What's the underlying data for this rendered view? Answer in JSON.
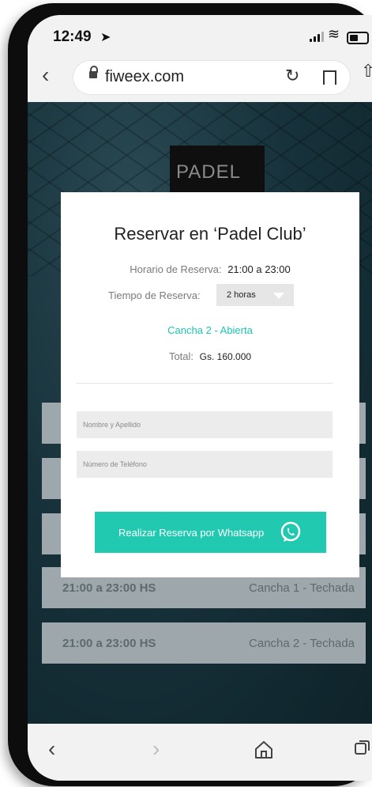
{
  "status_bar": {
    "time": "12:49"
  },
  "address_bar": {
    "url": "fiweex.com"
  },
  "background": {
    "logo_text": "PADEL",
    "slots": [
      {
        "time": "21:00 a 23:00 HS",
        "court": "Cancha 1 - Techada"
      },
      {
        "time": "21:00 a 23:00 HS",
        "court": "Cancha 2 - Techada"
      }
    ]
  },
  "modal": {
    "title": "Reservar en ‘Padel Club’",
    "schedule_label": "Horario de Reserva:",
    "schedule_value": "21:00 a 23:00",
    "duration_label": "Tiempo de Reserva:",
    "duration_value": "2 horas",
    "court_status": "Cancha 2 - Abierta",
    "total_label": "Total:",
    "total_value": "Gs. 160.000",
    "name_placeholder": "Nombre y Apellido",
    "phone_placeholder": "Número de Teléfono",
    "submit_label": "Realizar Reserva por Whatsapp"
  },
  "colors": {
    "accent": "#21c9b1",
    "court_text": "#1bc7b1",
    "page_bg": "#17323b",
    "slot_bg": "#9ea7ab"
  },
  "icons": {
    "status": [
      "location-arrow-icon",
      "signal-icon",
      "wifi-icon",
      "battery-icon"
    ],
    "browser": [
      "back-chevron-icon",
      "lock-icon",
      "reload-icon",
      "bookmark-icon",
      "share-icon"
    ],
    "toolbar": [
      "back-icon",
      "forward-icon",
      "home-icon",
      "tabs-icon"
    ],
    "modal": [
      "whatsapp-icon",
      "chevron-down-icon"
    ]
  }
}
